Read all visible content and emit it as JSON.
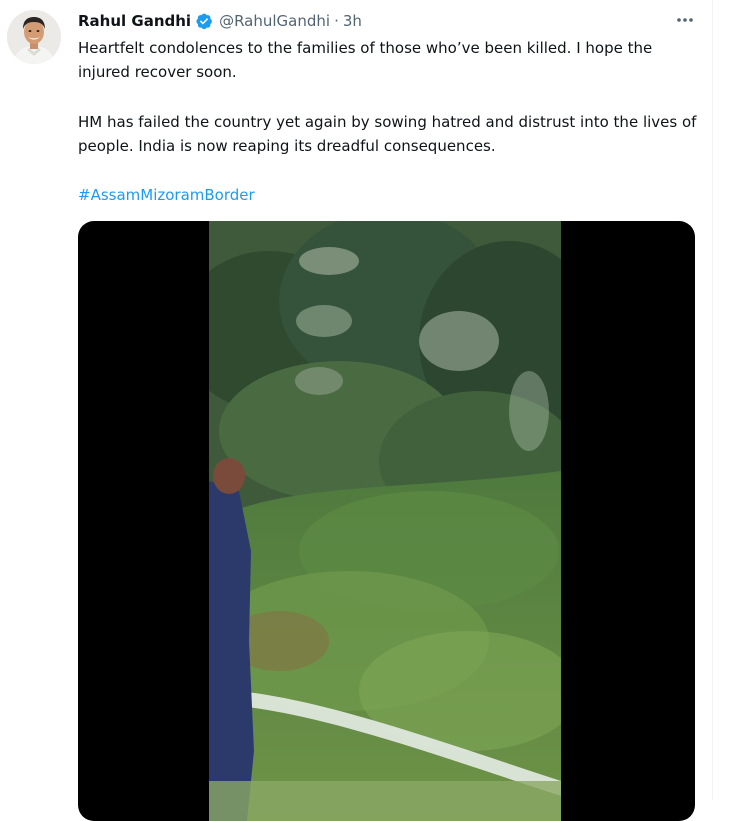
{
  "tweet": {
    "author_name": "Rahul Gandhi",
    "handle": "@RahulGandhi",
    "separator": "·",
    "time": "3h",
    "paragraph1": "Heartfelt condolences to the families of those who’ve been killed. I hope the injured recover soon.",
    "paragraph2": "HM has failed the country yet again by sowing hatred and distrust into the lives of people. India is now reaping its dreadful consequences.",
    "hashtag": "#AssamMizoramBorder"
  },
  "icons": {
    "verified": "verified-badge-icon",
    "more": "more-options-icon"
  },
  "colors": {
    "link": "#1d9bf0",
    "verified": "#1d9bf0",
    "secondary_text": "#536471",
    "text": "#0f1419"
  }
}
